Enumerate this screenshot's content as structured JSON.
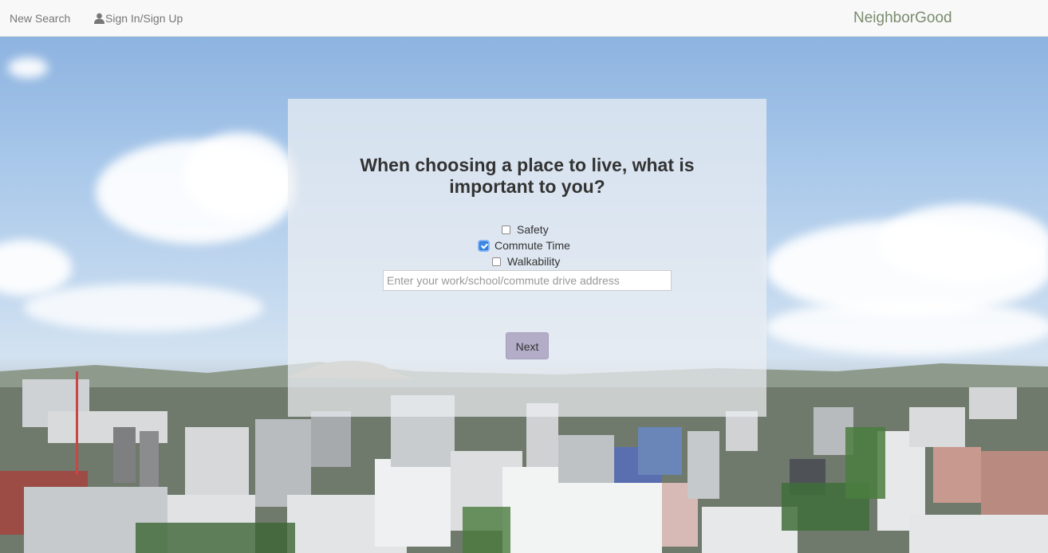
{
  "nav": {
    "new_search": "New Search",
    "sign_in": "Sign In/Sign Up",
    "brand": "NeighborGood"
  },
  "form": {
    "question_line1": "When choosing a place to live, what is",
    "question_line2": "important to you?",
    "options": [
      {
        "label": "Safety",
        "checked": false
      },
      {
        "label": "Commute Time",
        "checked": true
      },
      {
        "label": "Walkability",
        "checked": false
      }
    ],
    "address_placeholder": "Enter your work/school/commute drive address",
    "next_label": "Next"
  },
  "colors": {
    "brand": "#7a8c6e",
    "next_button": "#b3adc8",
    "checkbox_checked": "#3d8be8"
  },
  "icons": {
    "user": "user-icon"
  }
}
